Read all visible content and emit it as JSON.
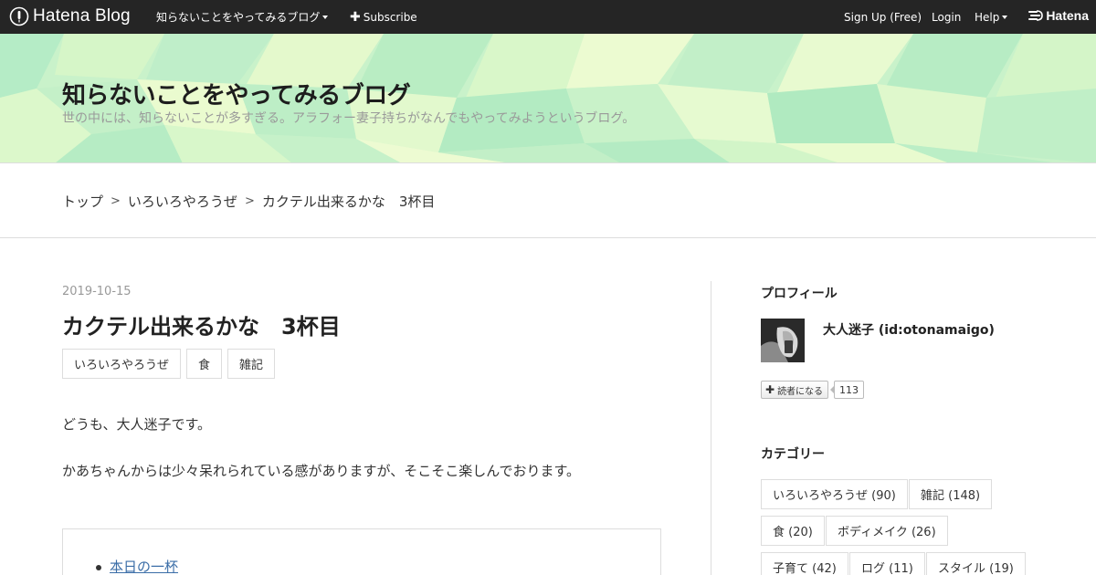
{
  "topbar": {
    "logo_text": "Hatena Blog",
    "blog_menu": "知らないことをやってみるブログ",
    "subscribe": "Subscribe",
    "signup": "Sign Up (Free)",
    "login": "Login",
    "help": "Help",
    "brand": "Hatena"
  },
  "header": {
    "title": "知らないことをやってみるブログ",
    "description": "世の中には、知らないことが多すぎる。アラフォー妻子持ちがなんでもやってみようというブログ。"
  },
  "breadcrumb": {
    "items": [
      "トップ",
      "いろいろやろうぜ",
      "カクテル出来るかな　3杯目"
    ],
    "separator": ">"
  },
  "entry": {
    "date": "2019-10-15",
    "title": "カクテル出来るかな　3杯目",
    "tags": [
      "いろいろやろうぜ",
      "食",
      "雑記"
    ],
    "paragraphs": [
      "どうも、大人迷子です。",
      "かあちゃんからは少々呆れられている感がありますが、そこそこ楽しんでおります。"
    ],
    "toc": [
      "本日の一杯"
    ]
  },
  "sidebar": {
    "profile_heading": "プロフィール",
    "profile_name": "大人迷子 (id:otonamaigo)",
    "reader_button": "読者になる",
    "reader_count": "113",
    "category_heading": "カテゴリー",
    "categories": [
      "いろいろやろうぜ (90)",
      "雑記 (148)",
      "食 (20)",
      "ボディメイク (26)",
      "子育て (42)",
      "ログ (11)",
      "スタイル (19)"
    ]
  }
}
